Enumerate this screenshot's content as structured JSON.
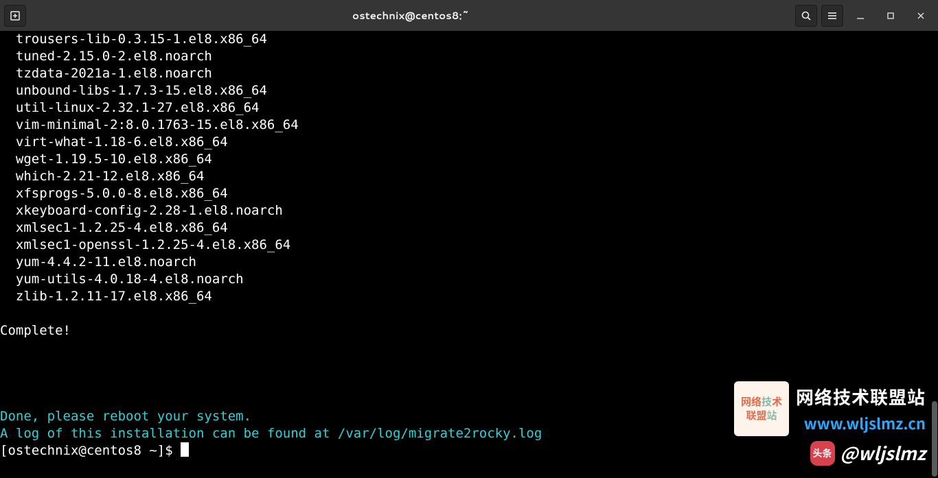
{
  "titlebar": {
    "title": "ostechnix@centos8:~",
    "new_tab_icon": "new-tab-icon",
    "search_icon": "search-icon",
    "menu_icon": "hamburger-icon",
    "minimize_icon": "minimize-icon",
    "maximize_icon": "maximize-icon",
    "close_icon": "close-icon"
  },
  "terminal": {
    "packages": [
      "  trousers-lib-0.3.15-1.el8.x86_64",
      "  tuned-2.15.0-2.el8.noarch",
      "  tzdata-2021a-1.el8.noarch",
      "  unbound-libs-1.7.3-15.el8.x86_64",
      "  util-linux-2.32.1-27.el8.x86_64",
      "  vim-minimal-2:8.0.1763-15.el8.x86_64",
      "  virt-what-1.18-6.el8.x86_64",
      "  wget-1.19.5-10.el8.x86_64",
      "  which-2.21-12.el8.x86_64",
      "  xfsprogs-5.0.0-8.el8.x86_64",
      "  xkeyboard-config-2.28-1.el8.noarch",
      "  xmlsec1-1.2.25-4.el8.x86_64",
      "  xmlsec1-openssl-1.2.25-4.el8.x86_64",
      "  yum-4.4.2-11.el8.noarch",
      "  yum-utils-4.0.18-4.el8.noarch",
      "  zlib-1.2.11-17.el8.x86_64"
    ],
    "complete_msg": "Complete!",
    "done_line1": "Done, please reboot your system.",
    "done_line2": "A log of this installation can be found at /var/log/migrate2rocky.log",
    "prompt": "[ostechnix@centos8 ~]$ "
  },
  "watermark": {
    "box_line1a": "网络",
    "box_line1b": "技",
    "box_line1c": "术",
    "box_line2a": "联盟",
    "box_line2b": "站",
    "title": "网络技术联盟站",
    "url": "www.wljslmz.cn",
    "avatar_text": "头条",
    "handle": "@wljslmz"
  }
}
